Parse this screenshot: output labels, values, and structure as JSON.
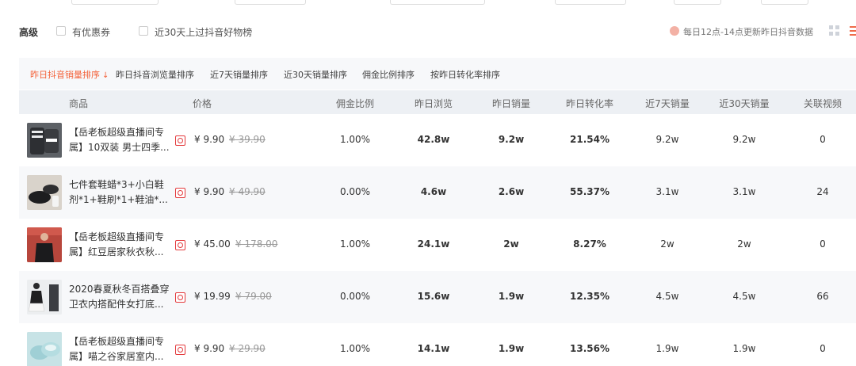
{
  "filters": {
    "label": "高级",
    "options": [
      {
        "label": "有优惠券",
        "checked": false
      },
      {
        "label": "近30天上过抖音好物榜",
        "checked": false
      }
    ],
    "notice": "每日12点-14点更新昨日抖音数据"
  },
  "sort_tabs": [
    {
      "label": "昨日抖音销量排序",
      "active": true
    },
    {
      "label": "昨日抖音浏览量排序",
      "active": false
    },
    {
      "label": "近7天销量排序",
      "active": false
    },
    {
      "label": "近30天销量排序",
      "active": false
    },
    {
      "label": "佣金比例排序",
      "active": false
    },
    {
      "label": "按昨日转化率排序",
      "active": false
    }
  ],
  "columns": {
    "product": "商品",
    "price": "价格",
    "commission": "佣金比例",
    "views": "昨日浏览",
    "sales": "昨日销量",
    "conversion": "昨日转化率",
    "sales7": "近7天销量",
    "sales30": "近30天销量",
    "videos": "关联视频"
  },
  "rows": [
    {
      "name": "【岳老板超级直播间专属】10双装 男士四季...",
      "price": "¥ 9.90",
      "orig_price": "¥ 39.90",
      "commission": "1.00%",
      "views": "42.8w",
      "sales": "9.2w",
      "conversion": "21.54%",
      "sales7": "9.2w",
      "sales30": "9.2w",
      "videos": "0"
    },
    {
      "name": "七件套鞋蜡*3+小白鞋剂*1+鞋刷*1+鞋油*...",
      "price": "¥ 9.90",
      "orig_price": "¥ 49.90",
      "commission": "0.00%",
      "views": "4.6w",
      "sales": "2.6w",
      "conversion": "55.37%",
      "sales7": "3.1w",
      "sales30": "3.1w",
      "videos": "24"
    },
    {
      "name": "【岳老板超级直播间专属】红豆居家秋衣秋...",
      "price": "¥ 45.00",
      "orig_price": "¥ 178.00",
      "commission": "1.00%",
      "views": "24.1w",
      "sales": "2w",
      "conversion": "8.27%",
      "sales7": "2w",
      "sales30": "2w",
      "videos": "0"
    },
    {
      "name": "2020春夏秋冬百搭叠穿卫衣内搭配件女打底...",
      "price": "¥ 19.99",
      "orig_price": "¥ 79.00",
      "commission": "0.00%",
      "views": "15.6w",
      "sales": "1.9w",
      "conversion": "12.35%",
      "sales7": "4.5w",
      "sales30": "4.5w",
      "videos": "66"
    },
    {
      "name": "【岳老板超级直播间专属】喵之谷家居室内...",
      "price": "¥ 9.90",
      "orig_price": "¥ 29.90",
      "commission": "1.00%",
      "views": "14.1w",
      "sales": "1.9w",
      "conversion": "13.56%",
      "sales7": "1.9w",
      "sales30": "1.9w",
      "videos": "0"
    }
  ],
  "colors": {
    "accent": "#f4623a",
    "shop_icon": "#e4393c",
    "header_bg": "#edf0f4",
    "alt_row_bg": "#f7f8fa"
  }
}
